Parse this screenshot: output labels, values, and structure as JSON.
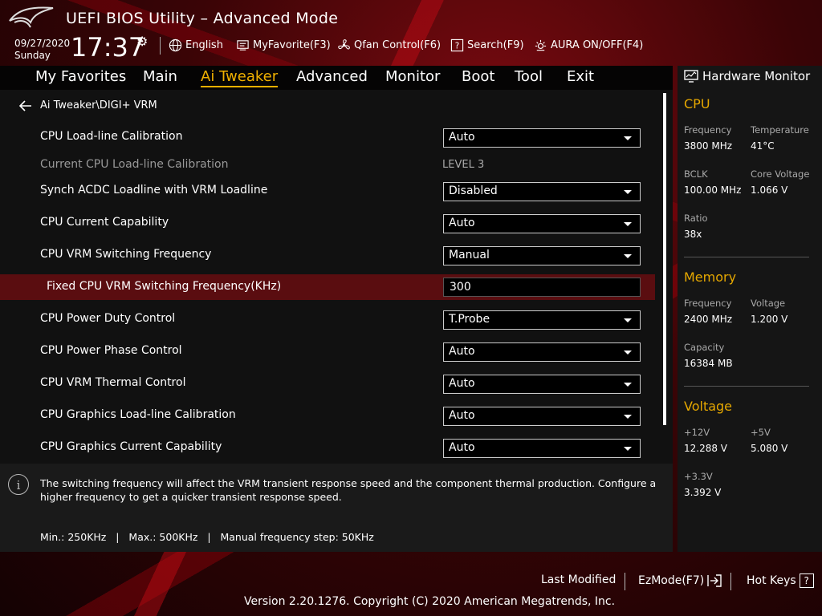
{
  "header": {
    "title": "UEFI BIOS Utility – Advanced Mode",
    "date": "09/27/2020",
    "day": "Sunday",
    "time": "17:37",
    "tools": {
      "language": "English",
      "myfavorite": "MyFavorite(F3)",
      "qfan": "Qfan Control(F6)",
      "search": "Search(F9)",
      "aura": "AURA ON/OFF(F4)"
    }
  },
  "menu": {
    "tabs": [
      "My Favorites",
      "Main",
      "Ai Tweaker",
      "Advanced",
      "Monitor",
      "Boot",
      "Tool",
      "Exit"
    ],
    "active": "Ai Tweaker"
  },
  "breadcrumb": "Ai Tweaker\\DIGI+ VRM",
  "settings": [
    {
      "label": "CPU Load-line Calibration",
      "value": "Auto"
    },
    {
      "label": "Current CPU Load-line Calibration",
      "value": "LEVEL 3"
    },
    {
      "label": "Synch ACDC Loadline with VRM Loadline",
      "value": "Disabled"
    },
    {
      "label": "CPU Current Capability",
      "value": "Auto"
    },
    {
      "label": "CPU VRM Switching Frequency",
      "value": "Manual"
    },
    {
      "label": "Fixed CPU VRM Switching Frequency(KHz)",
      "value": "300"
    },
    {
      "label": "CPU Power Duty Control",
      "value": "T.Probe"
    },
    {
      "label": "CPU Power Phase Control",
      "value": "Auto"
    },
    {
      "label": "CPU VRM Thermal Control",
      "value": "Auto"
    },
    {
      "label": "CPU Graphics Load-line Calibration",
      "value": "Auto"
    },
    {
      "label": "CPU Graphics Current Capability",
      "value": "Auto"
    }
  ],
  "help": {
    "text": "The switching frequency will affect the VRM transient response speed and the component thermal production. Configure a higher frequency to get a quicker transient response speed.",
    "range": "Min.: 250KHz   |   Max.: 500KHz   |   Manual frequency step: 50KHz"
  },
  "monitor": {
    "title": "Hardware Monitor",
    "cpu": {
      "heading": "CPU",
      "frequency_label": "Frequency",
      "frequency": "3800 MHz",
      "temperature_label": "Temperature",
      "temperature": "41°C",
      "bclk_label": "BCLK",
      "bclk": "100.00 MHz",
      "core_voltage_label": "Core Voltage",
      "core_voltage": "1.066 V",
      "ratio_label": "Ratio",
      "ratio": "38x"
    },
    "memory": {
      "heading": "Memory",
      "frequency_label": "Frequency",
      "frequency": "2400 MHz",
      "voltage_label": "Voltage",
      "voltage": "1.200 V",
      "capacity_label": "Capacity",
      "capacity": "16384 MB"
    },
    "voltage": {
      "heading": "Voltage",
      "v12_label": "+12V",
      "v12": "12.288 V",
      "v5_label": "+5V",
      "v5": "5.080 V",
      "v33_label": "+3.3V",
      "v33": "3.392 V"
    }
  },
  "footer": {
    "last_modified": "Last Modified",
    "ezmode": "EzMode(F7)",
    "hotkeys": "Hot Keys",
    "hotkeys_key": "?",
    "version": "Version 2.20.1276. Copyright (C) 2020 American Megatrends, Inc."
  },
  "colors": {
    "accent": "#f0b000",
    "section": "#e6a800",
    "highlight_row": "#5a0d10"
  }
}
